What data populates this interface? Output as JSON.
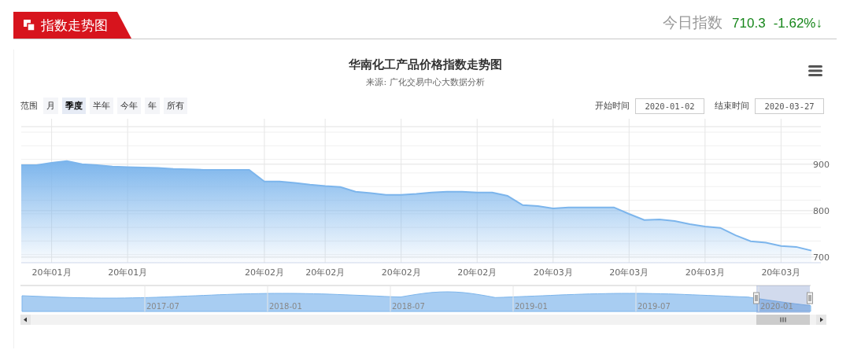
{
  "header": {
    "title": "指数走势图",
    "today_label": "今日指数",
    "today_value": "710.3",
    "today_change": "-1.62%↓"
  },
  "panel": {
    "title": "华南化工产品价格指数走势图",
    "subtitle": "来源: 广化交易中心大数据分析",
    "range_label": "范围",
    "range_buttons": [
      {
        "label": "月",
        "selected": false
      },
      {
        "label": "季度",
        "selected": true
      },
      {
        "label": "半年",
        "selected": false
      },
      {
        "label": "今年",
        "selected": false
      },
      {
        "label": "年",
        "selected": false
      },
      {
        "label": "所有",
        "selected": false
      }
    ],
    "start_label": "开始时间",
    "start_date": "2020-01-02",
    "end_label": "结束时间",
    "end_date": "2020-03-27",
    "chart_data": {
      "type": "area",
      "grid": true,
      "ylim": [
        688,
        981
      ],
      "categories": [
        null,
        null,
        "20年01月",
        null,
        null,
        null,
        null,
        "20年01月",
        null,
        null,
        null,
        null,
        null,
        null,
        null,
        null,
        "20年02月",
        null,
        null,
        null,
        "20年02月",
        null,
        null,
        null,
        null,
        "20年02月",
        null,
        null,
        null,
        null,
        "20年02月",
        null,
        null,
        null,
        null,
        "20年03月",
        null,
        null,
        null,
        null,
        "20年03月",
        null,
        null,
        null,
        null,
        "20年03月",
        null,
        null,
        null,
        null,
        "20年03月",
        null,
        null
      ],
      "series": [
        {
          "color": "#7cb5ec",
          "values": [
            898,
            898,
            903,
            907,
            900,
            898,
            895,
            894,
            893,
            892,
            890,
            889,
            888,
            888,
            888,
            888,
            863,
            863,
            860,
            856,
            853,
            851,
            841,
            838,
            834,
            834,
            836,
            839,
            841,
            841,
            839,
            839,
            832,
            812,
            810,
            805,
            807,
            807,
            807,
            807,
            793,
            780,
            781,
            778,
            771,
            766,
            763,
            747,
            734,
            731,
            724,
            722,
            714
          ]
        }
      ],
      "yticks": [
        700,
        800,
        900
      ]
    },
    "navigator": {
      "labels": [
        "2017-07",
        "2018-01",
        "2018-07",
        "2019-01",
        "2019-07",
        "2020-01"
      ]
    }
  }
}
